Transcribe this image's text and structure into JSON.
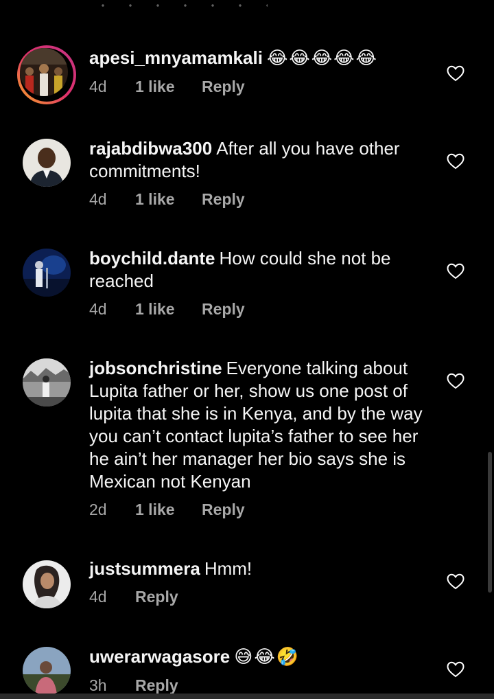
{
  "comments": [
    {
      "username": "apesi_mnyamamkali",
      "text": "",
      "emoji": "😂😂😂😂😂",
      "time": "4d",
      "likes": "1 like",
      "reply": "Reply"
    },
    {
      "username": "rajabdibwa300",
      "text": "After all you have other commitments!",
      "emoji": "",
      "time": "4d",
      "likes": "1 like",
      "reply": "Reply"
    },
    {
      "username": "boychild.dante",
      "text": "How could she not be reached",
      "emoji": "",
      "time": "4d",
      "likes": "1 like",
      "reply": "Reply"
    },
    {
      "username": "jobsonchristine",
      "text": "Everyone talking about Lupita father or her, show us one post of lupita that she is in Kenya, and by the way you can’t contact lupita’s father to see her he ain’t her manager her bio says she is Mexican not Kenyan",
      "emoji": "",
      "time": "2d",
      "likes": "1 like",
      "reply": "Reply"
    },
    {
      "username": "justsummera",
      "text": "Hmm!",
      "emoji": "",
      "time": "4d",
      "likes": "",
      "reply": "Reply"
    },
    {
      "username": "uwerarwagasore",
      "text": "",
      "emoji": "😅😂🤣",
      "time": "3h",
      "likes": "",
      "reply": "Reply"
    }
  ],
  "colors": {
    "background": "#000000",
    "text": "#f5f5f5",
    "meta": "#a8a8a8",
    "story_ring_start": "#f9a825",
    "story_ring_end": "#c13584"
  },
  "icons": {
    "like": "heart-outline-icon"
  }
}
